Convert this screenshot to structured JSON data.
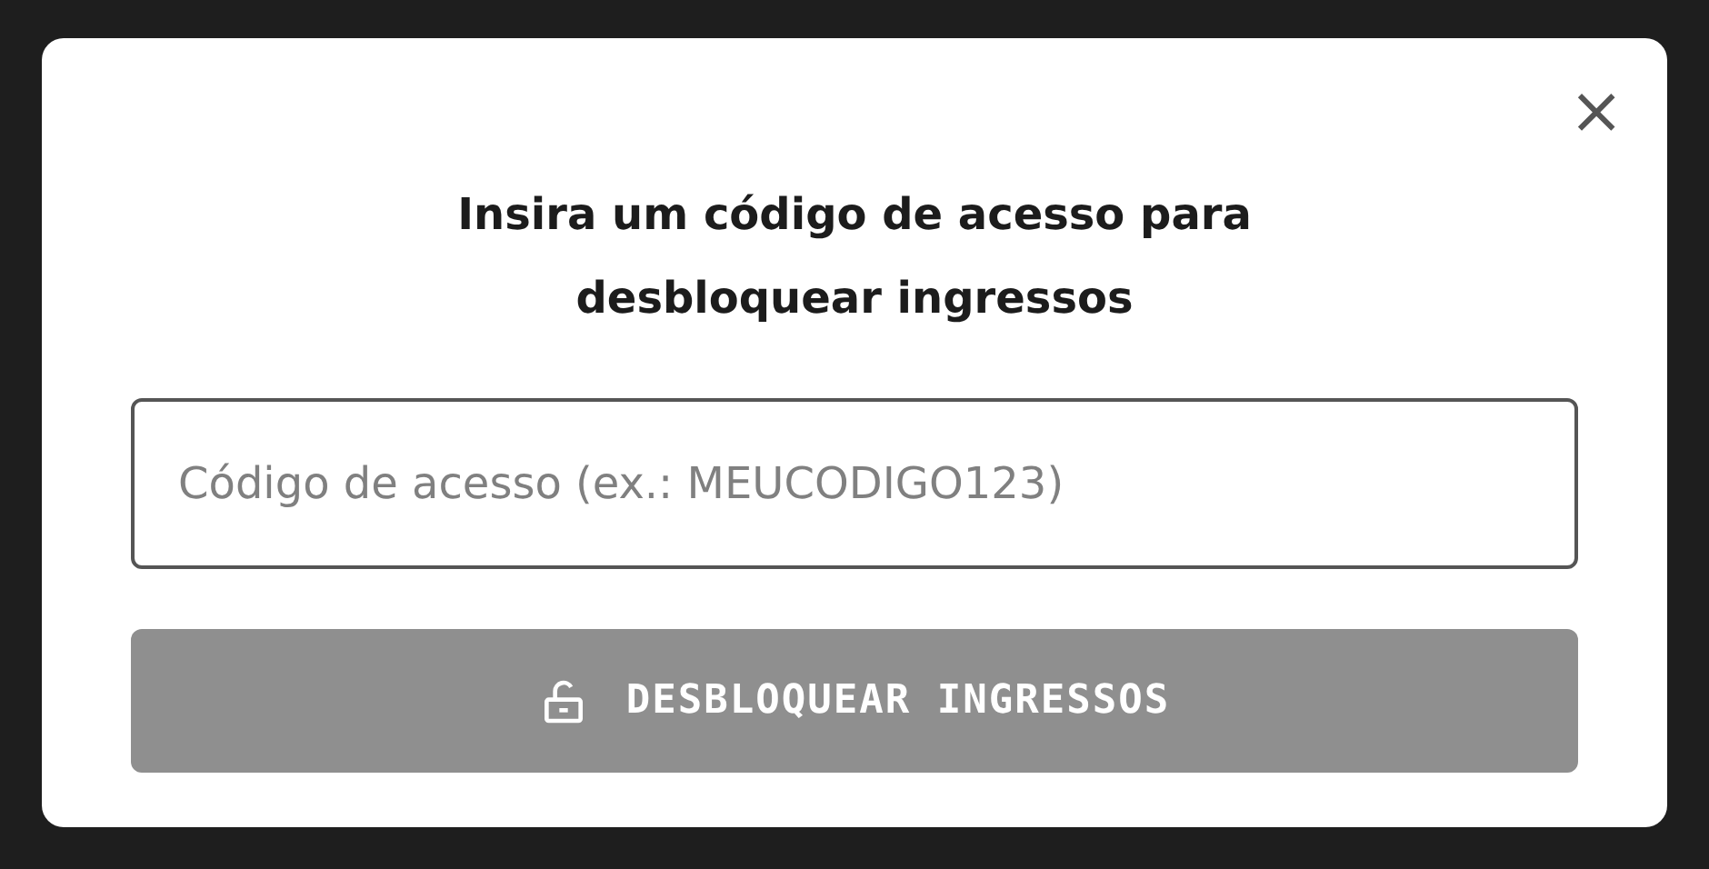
{
  "dialog": {
    "title": "Insira um código de acesso para desbloquear ingressos",
    "close_label": "×",
    "access_code": {
      "placeholder": "Código de acesso (ex.: MEUCODIGO123)"
    },
    "unlock_button": {
      "label": "DESBLOQUEAR INGRESSOS",
      "disabled": true
    }
  }
}
